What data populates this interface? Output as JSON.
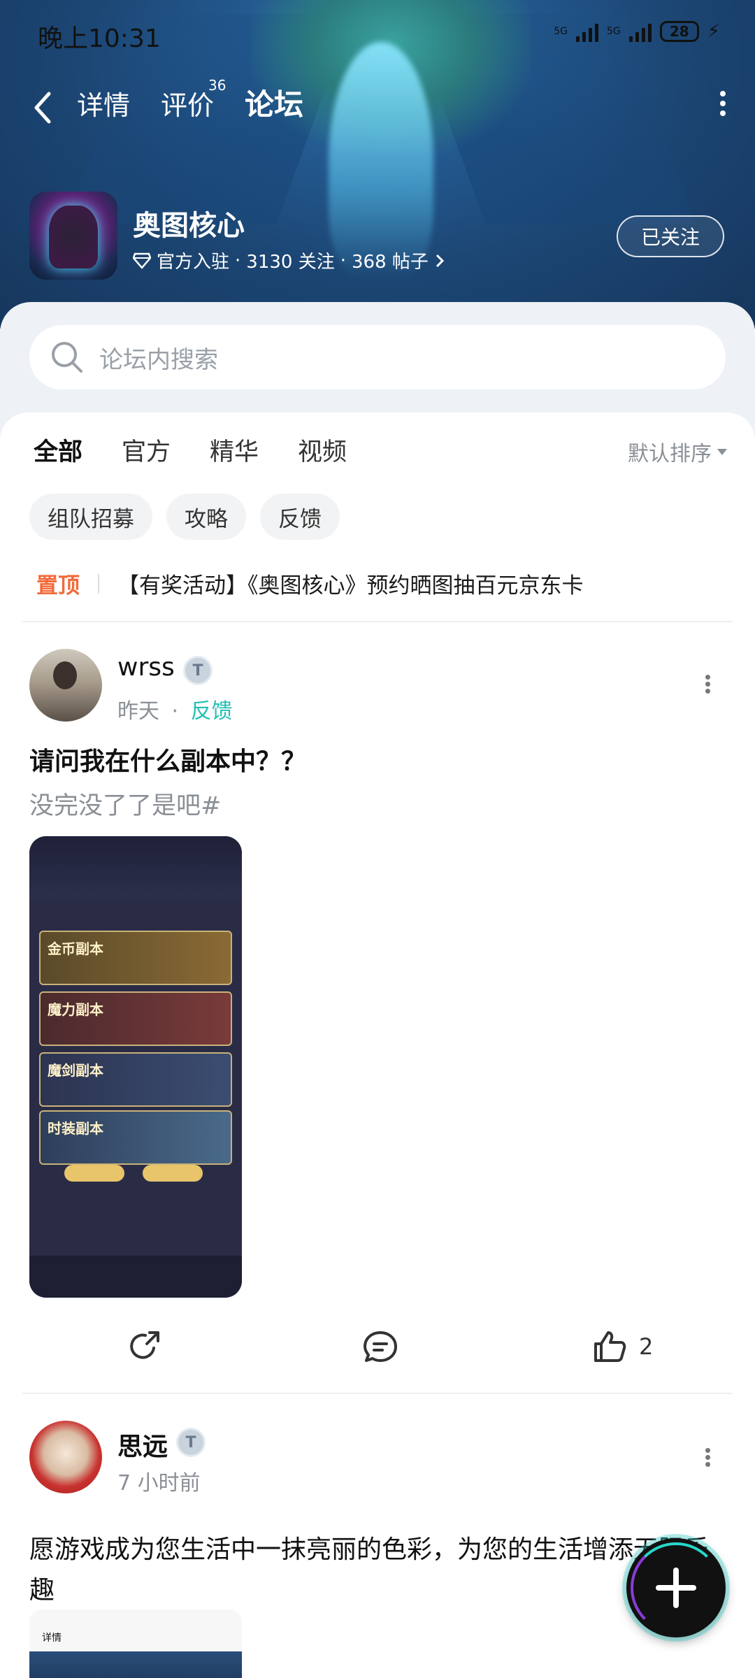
{
  "status_bar": {
    "time": "晚上10:31",
    "network_1": "5G",
    "network_2": "5G",
    "battery": "28"
  },
  "nav": {
    "tabs": [
      {
        "label": "详情"
      },
      {
        "label": "评价",
        "count": "36"
      },
      {
        "label": "论坛"
      }
    ],
    "active_tab": "论坛"
  },
  "game": {
    "name": "奥图核心",
    "official": "官方入驻",
    "followers": "3130 关注",
    "posts": "368 帖子",
    "follow_button": "已关注"
  },
  "search": {
    "placeholder": "论坛内搜索"
  },
  "filters": {
    "tabs": [
      "全部",
      "官方",
      "精华",
      "视频"
    ],
    "active": "全部",
    "sort": "默认排序",
    "chips": [
      "组队招募",
      "攻略",
      "反馈"
    ]
  },
  "pinned": {
    "tag": "置顶",
    "title": "【有奖活动】《奥图核心》预约晒图抽百元京东卡"
  },
  "posts": [
    {
      "author": "wrss",
      "time": "昨天",
      "separator": "·",
      "category": "反馈",
      "title": "请问我在什么副本中？？",
      "body": "没完没了了是吧#",
      "image_labels": [
        "金币副本",
        "魔力副本",
        "魔剑副本",
        "时装副本"
      ],
      "likes": "2"
    },
    {
      "author": "思远",
      "time": "7 小时前",
      "body": "愿游戏成为您生活中一抹亮丽的色彩，为您的生活增添无限乐趣",
      "image_header": "详情"
    }
  ],
  "colors": {
    "accent": "#24d2c6",
    "pinned": "#f26a3a",
    "category": "#20bfb2"
  }
}
